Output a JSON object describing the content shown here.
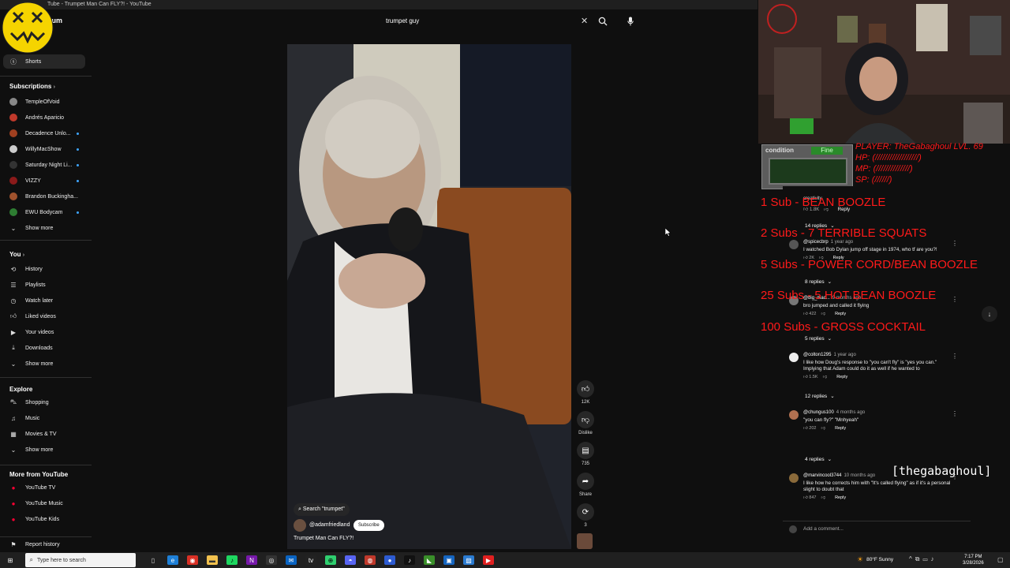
{
  "window": {
    "title": "Tube - Trumpet Man Can FLY?! - YouTube"
  },
  "logo": {
    "text": "mium"
  },
  "search": {
    "value": "trumpet guy"
  },
  "sidebar": {
    "shorts_label": "Shorts",
    "subscriptions_header": "Subscriptions",
    "subscriptions": [
      {
        "label": "TempleOfVoid",
        "color": "#888",
        "dot": false
      },
      {
        "label": "Andrés Aparicio",
        "color": "#c0392b",
        "dot": false
      },
      {
        "label": "Decadence Unlo...",
        "color": "#a04020",
        "dot": true
      },
      {
        "label": "WillyMacShow",
        "color": "#ccc",
        "dot": true
      },
      {
        "label": "Saturday Night Li...",
        "color": "#333",
        "dot": true
      },
      {
        "label": "VIZZY",
        "color": "#8b1a1a",
        "dot": true
      },
      {
        "label": "Brandon Buckingha...",
        "color": "#a0522d",
        "dot": false
      },
      {
        "label": "EWU Bodycam",
        "color": "#2e7d32",
        "dot": true
      }
    ],
    "show_more": "Show more",
    "you_header": "You",
    "you_items": [
      "History",
      "Playlists",
      "Watch later",
      "Liked videos",
      "Your videos",
      "Downloads"
    ],
    "explore_header": "Explore",
    "explore_items": [
      "Shopping",
      "Music",
      "Movies & TV"
    ],
    "more_header": "More from YouTube",
    "more_items": [
      "YouTube TV",
      "YouTube Music",
      "YouTube Kids"
    ],
    "report_history": "Report history"
  },
  "short": {
    "search_chip": "Search \"trumpet\"",
    "channel": "@adamfriedland",
    "subscribe": "Subscribe",
    "title": "Trumpet Man Can FLY?!",
    "like_count": "12K",
    "dislike_label": "Dislike",
    "comment_count": "735",
    "share_label": "Share",
    "remix_count": "3"
  },
  "comments": {
    "top_fragment": "creativity",
    "top_likes": "1.8K",
    "reply_label": "Reply",
    "items": [
      {
        "replies_above": "14 replies",
        "handle": "@spicecbrp",
        "age": "1 year ago",
        "text": "I watched Bob Dylan jump off stage in 1974, who tf are you?!",
        "likes": "2K",
        "color": "#555"
      },
      {
        "replies_above": "8 replies",
        "handle": "@big_mac...",
        "age": "9 months ago",
        "text": "bro jumped and called it flying",
        "likes": "422",
        "color": "#777"
      },
      {
        "replies_above": "5 replies",
        "handle": "@colton1295",
        "age": "1 year ago",
        "text": "I like how Doug's response to \"you can't fly\" is \"yes you can.\" Implying that Adam could do it as well if he wanted to",
        "likes": "1.5K",
        "color": "#eee"
      },
      {
        "replies_above": "12 replies",
        "handle": "@chungus100",
        "age": "4 months ago",
        "text": "\"you can fly?\" \"Mnhyeah\"",
        "likes": "202",
        "color": "#b07050"
      },
      {
        "replies_above": "4 replies",
        "handle": "@marvincool3744",
        "age": "10 months ago",
        "text": "I like how he corrects him with \"It's called flying\" as if it's a personal slight to doubt that",
        "likes": "847",
        "color": "#8a6a3a"
      }
    ],
    "add_comment": "Add a comment..."
  },
  "stream_overlay": {
    "player_lines": [
      "PLAYER: TheGabaghoul LVL. 69",
      "HP:    (//////////////////)",
      "MP:    (//////////////)",
      "SP:  (//////)"
    ],
    "condition_label": "condition",
    "condition_value": "Fine",
    "sub_goals": [
      "1 Sub - BEAN BOOZLE",
      "2 Subs - 7 TERRIBLE SQUATS",
      "5 Subs - POWER CORD/BEAN BOOZLE",
      "25 Subs - 5 HOT BEAN BOOZLE",
      "100 Subs - GROSS COCKTAIL"
    ],
    "handle_tag": "[thegabaghoul]"
  },
  "taskbar": {
    "search_placeholder": "Type here to search",
    "weather": "80°F  Sunny",
    "time": "7:17 PM",
    "date": "3/28/2026"
  }
}
